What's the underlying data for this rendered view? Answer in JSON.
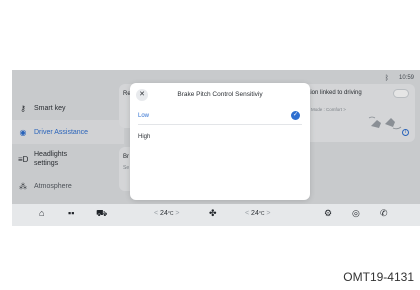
{
  "status_bar": {
    "bluetooth_icon": "bluetooth-icon",
    "time": "10:59"
  },
  "sidebar": {
    "items": [
      {
        "label": "Smart key",
        "icon": "key-icon"
      },
      {
        "label": "Driver Assistance",
        "icon": "steering-wheel-icon",
        "active": true
      },
      {
        "label_line1": "Headlights",
        "label_line2": "settings",
        "icon": "headlight-icon"
      },
      {
        "label": "Atmosphere",
        "icon": "ambient-light-icon"
      }
    ]
  },
  "cards": {
    "card_a_title": "Re",
    "card_b_title": "Br",
    "card_b_sub": "Se",
    "card_c_title": "nsation linked to driving",
    "card_c_sub": "iation Mode : Comfort  >"
  },
  "dialog": {
    "title": "Brake Pitch Control Sensitiviy",
    "options": [
      {
        "label": "Low",
        "selected": true
      },
      {
        "label": "High",
        "selected": false
      }
    ]
  },
  "dock": {
    "left_temp": "24",
    "right_temp": "24",
    "unit": "°C",
    "left_arrow": "<",
    "right_arrow": ">",
    "icons": [
      "home-icon",
      "apps-icon",
      "car-icon",
      "fan-icon",
      "settings-icon",
      "media-icon",
      "phone-icon"
    ]
  },
  "caption": "OMT19-4131",
  "colors": {
    "accent": "#2e6fd0",
    "screen_bg": "#dfe1e4"
  }
}
